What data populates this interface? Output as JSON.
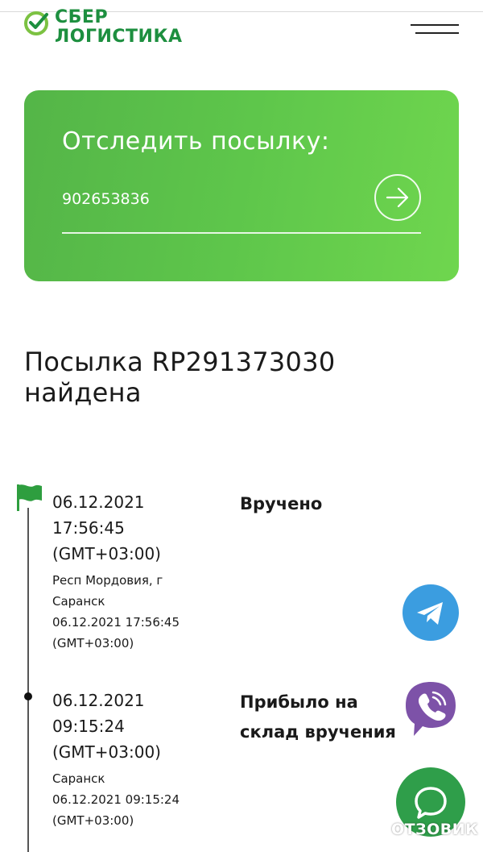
{
  "header": {
    "logo_line1": "СБЕР",
    "logo_line2": "ЛОГИСТИКА",
    "menu_icon": "burger-menu-icon"
  },
  "tracking": {
    "title": "Отследить посылку:",
    "input_value": "902653836",
    "submit_icon": "arrow-right-icon"
  },
  "result": {
    "title": "Посылка RP291373030 найдена"
  },
  "events": [
    {
      "date": "06.12.2021",
      "time": "17:56:45",
      "tz": "(GMT+03:00)",
      "place_line1": "Респ Мордовия, г",
      "place_line2": "Саранск",
      "place_datetime": "06.12.2021 17:56:45",
      "place_tz": "(GMT+03:00)",
      "status": "Вручено",
      "marker": "flag-icon"
    },
    {
      "date": "06.12.2021",
      "time": "09:15:24",
      "tz": "(GMT+03:00)",
      "place_line1": "Саранск",
      "place_datetime": "06.12.2021 09:15:24",
      "place_tz": "(GMT+03:00)",
      "status_line1": "Прибыло на",
      "status_line2": "склад вручения",
      "marker": "dot-icon"
    }
  ],
  "floating": {
    "telegram_icon": "telegram-icon",
    "viber_icon": "viber-icon",
    "chat_icon": "chat-icon"
  },
  "watermark": {
    "text": "ОТЗОВИК"
  },
  "colors": {
    "brand_green": "#1d8f3f",
    "card_green": "#5ec64b",
    "telegram_blue": "#3b9de0",
    "viber_purple": "#7d52a8",
    "chat_green": "#2f9e4a"
  }
}
